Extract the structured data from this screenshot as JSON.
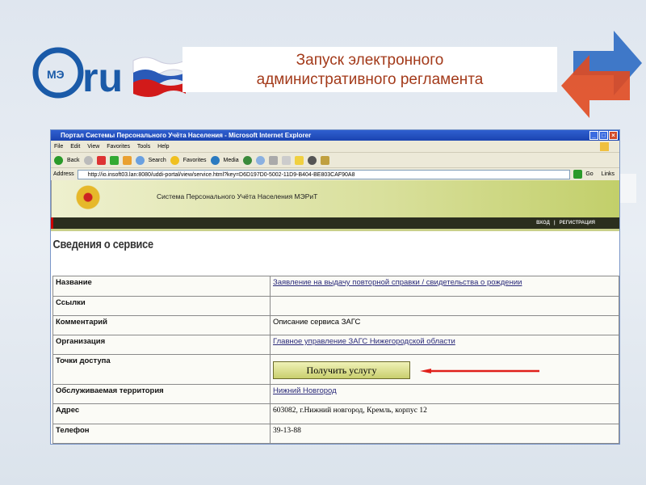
{
  "slide": {
    "title_line1": "Запуск электронного",
    "title_line2": "административного регламента",
    "logo_text": "МЭРиТ.ru"
  },
  "browser": {
    "title": "Портал Системы Персонального Учёта Населения - Microsoft Internet Explorer",
    "menu": [
      "File",
      "Edit",
      "View",
      "Favorites",
      "Tools",
      "Help"
    ],
    "toolbar": {
      "back": "Back",
      "search": "Search",
      "favorites": "Favorites",
      "media": "Media"
    },
    "address_label": "Address",
    "url": "http://io.insoft03.lan:8080/uddi-portal/view/service.html?key=D6D197D0-5002-11D9-B404-BE803CAF90A8",
    "go": "Go",
    "links": "Links"
  },
  "site": {
    "system_name": "Система Персонального Учёта Населения МЭРиТ",
    "login": "ВХОД",
    "separator": "|",
    "register": "РЕГИСТРАЦИЯ"
  },
  "page": {
    "heading": "Сведения о сервисе",
    "rows": [
      {
        "key": "Название",
        "value": "Заявление на выдачу повторной справки /  свидетельства о рождении",
        "link": true
      },
      {
        "key": "Ссылки",
        "value": ""
      },
      {
        "key": "Комментарий",
        "value": "Описание сервиса ЗАГС"
      },
      {
        "key": "Организация",
        "value": "Главное управление ЗАГС Нижегородской области",
        "link": true
      },
      {
        "key": "Точки доступа",
        "button": "Получить услугу"
      },
      {
        "key": "Обслуживаемая территория",
        "value": "Нижний Новгород",
        "link": true
      },
      {
        "key": "Адрес",
        "value": "603082, г.Нижний новгород, Кремль, корпус 12"
      },
      {
        "key": "Телефон",
        "value": "39-13-88"
      }
    ]
  }
}
